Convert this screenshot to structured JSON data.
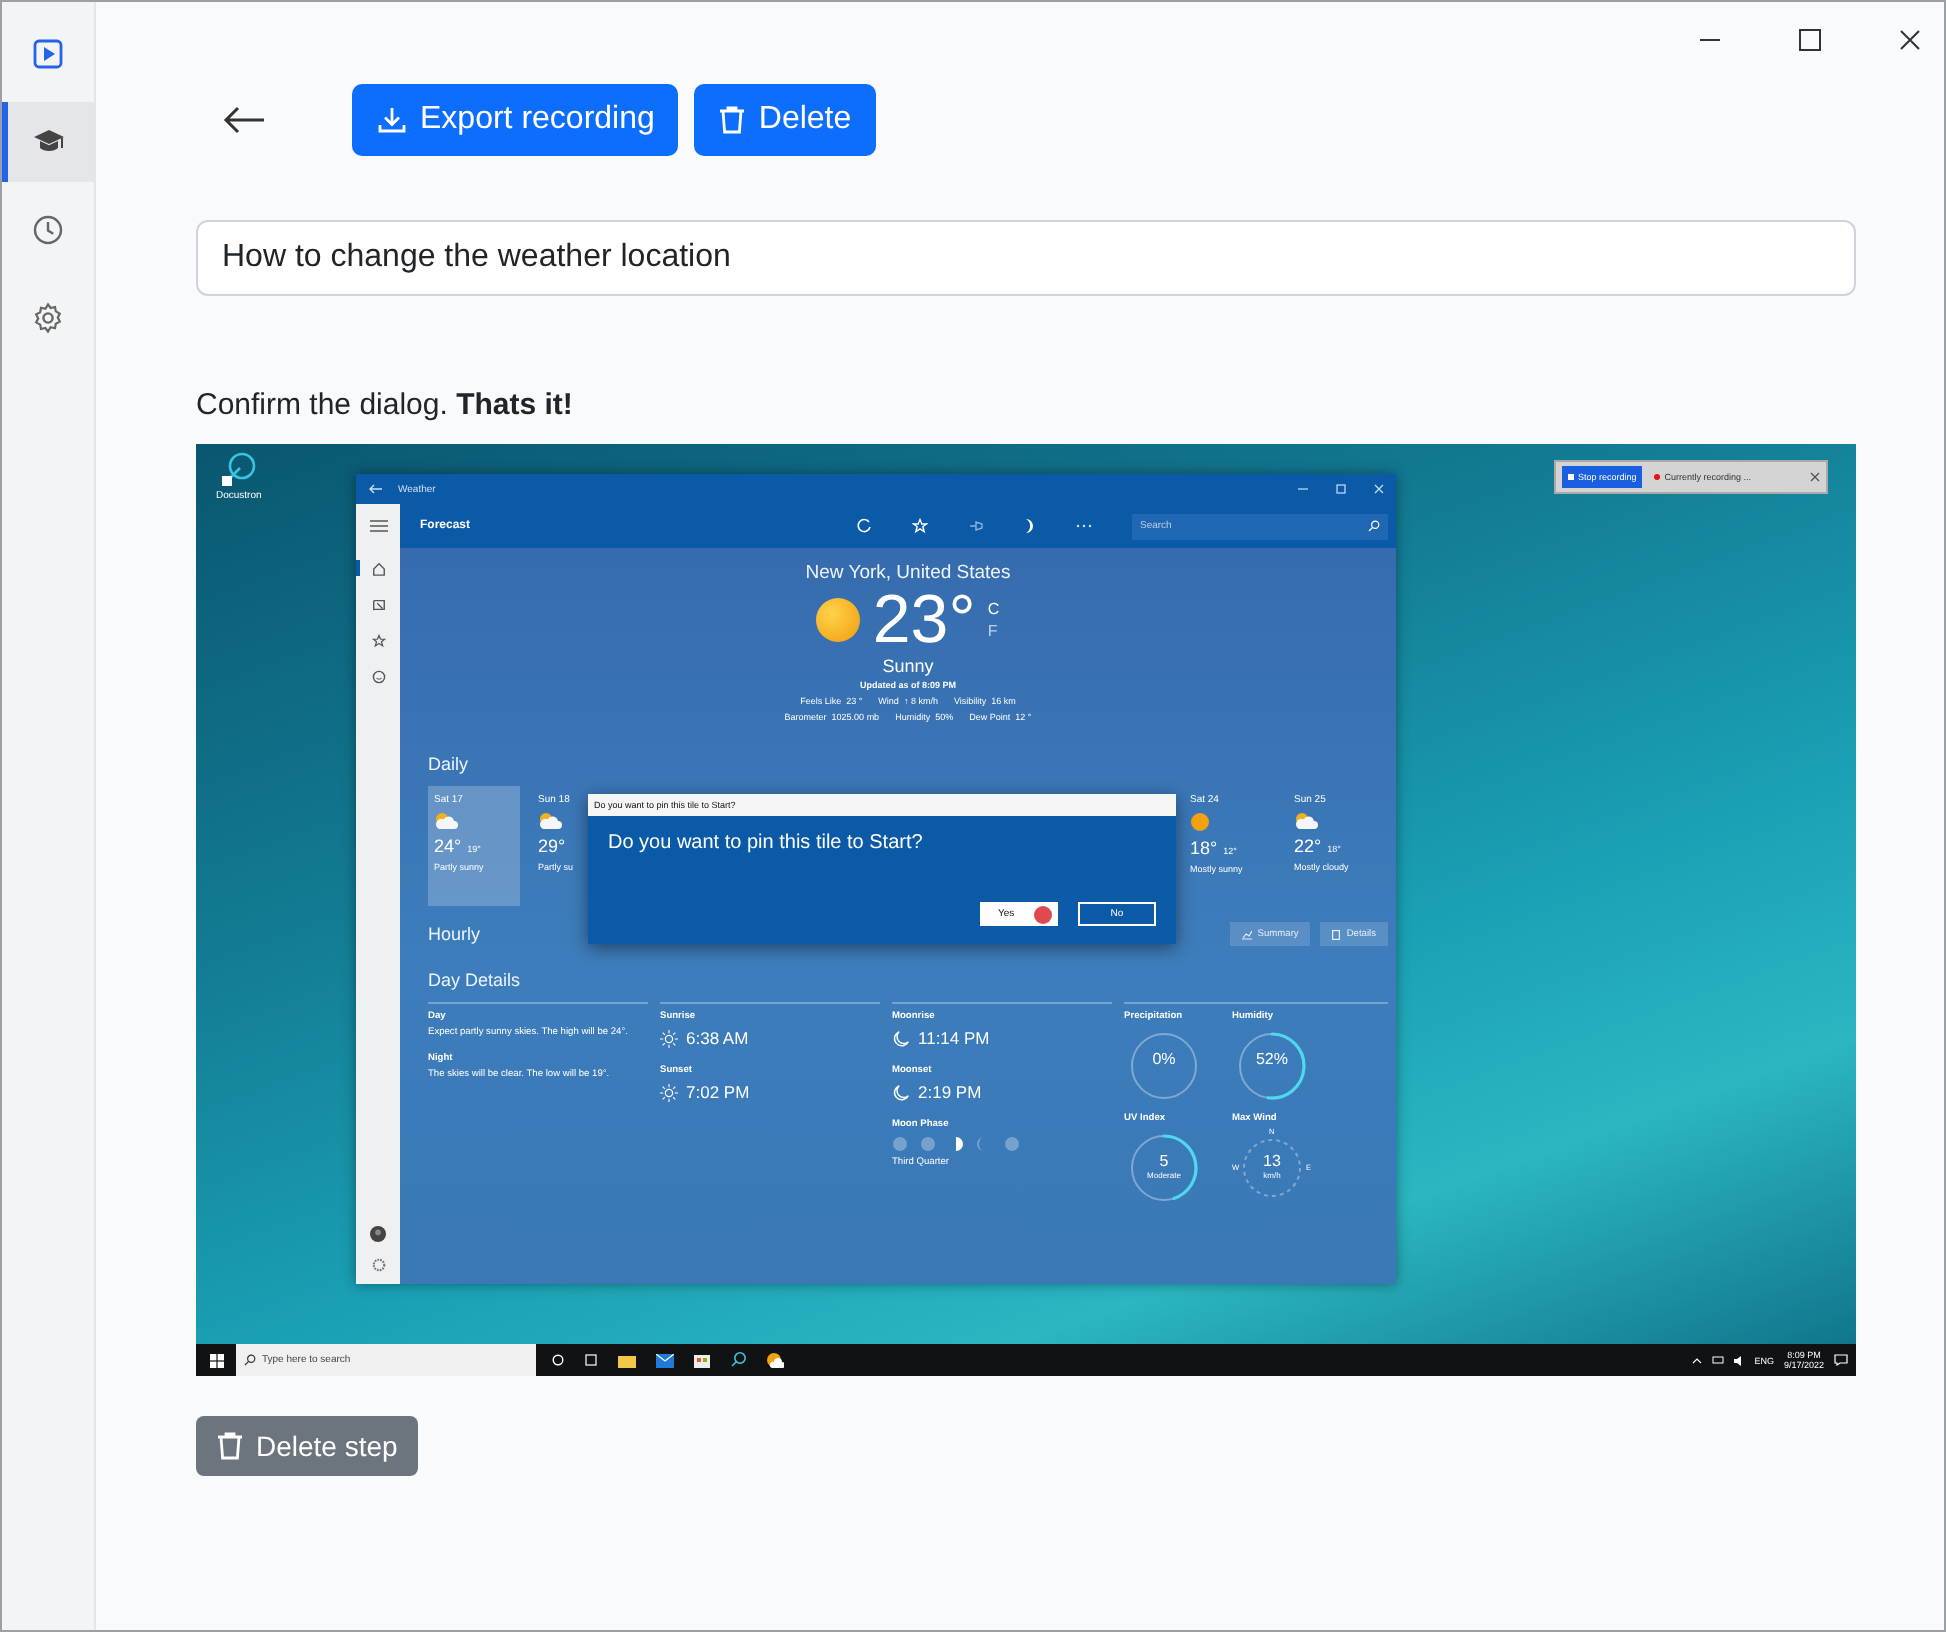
{
  "sidebar": {
    "items": [
      {
        "kind": "play",
        "selected": false
      },
      {
        "kind": "learn",
        "selected": true
      },
      {
        "kind": "history",
        "selected": false
      },
      {
        "kind": "settings",
        "selected": false
      }
    ]
  },
  "toolbar": {
    "buttons": [
      {
        "kind": "export",
        "label": "Export recording"
      },
      {
        "kind": "delete",
        "label": "Delete"
      }
    ]
  },
  "title_field": {
    "value": "How to change the weather location"
  },
  "step": {
    "description": "Confirm the dialog. **Thats it!**",
    "screenshot": {
      "desktop_icon": {
        "label": "Docustron"
      },
      "recorder": {
        "stop_button": "Stop recording",
        "status": "Currently recording ..."
      },
      "weather": {
        "title": "Weather",
        "header": "Forecast",
        "search_placeholder": "Search",
        "nav": [
          {
            "kind": "home",
            "selected": true
          },
          {
            "kind": "maps",
            "selected": false
          },
          {
            "kind": "favorites",
            "selected": false
          },
          {
            "kind": "news",
            "selected": false
          }
        ],
        "current": {
          "location": "New York, United States",
          "temperature": "23°",
          "units": [
            "C",
            "F"
          ],
          "condition": "Sunny",
          "updated": "Updated as of 8:09 PM",
          "details": [
            [
              {
                "label": "Feels Like",
                "value": "23 °"
              },
              {
                "label": "Wind",
                "value": "↑ 8 km/h"
              },
              {
                "label": "Visibility",
                "value": "16 km"
              }
            ],
            [
              {
                "label": "Barometer",
                "value": "1025.00 mb"
              },
              {
                "label": "Humidity",
                "value": "50%"
              },
              {
                "label": "Dew Point",
                "value": "12 °"
              }
            ]
          ]
        },
        "daily": {
          "heading": "Daily",
          "days": [
            {
              "day": "Sat 17",
              "high": "24°",
              "low": "19°",
              "summary": "Partly sunny",
              "kind": "partly-cloudy",
              "selected": true
            },
            {
              "day": "Sun 18",
              "high": "29°",
              "summary": "Partly su",
              "kind": "partly-cloudy",
              "selected": false
            },
            {
              "day": "Sat 24",
              "high": "18°",
              "low": "12°",
              "summary": "Mostly sunny",
              "kind": "sun",
              "selected": false
            },
            {
              "day": "Sun 25",
              "high": "22°",
              "low": "18°",
              "summary": "Mostly cloudy",
              "kind": "partly-cloudy",
              "selected": false
            }
          ]
        },
        "hourly": {
          "heading": "Hourly",
          "buttons": [
            {
              "kind": "chart",
              "label": "Summary"
            },
            {
              "kind": "list",
              "label": "Details"
            }
          ]
        },
        "day_details": {
          "heading": "Day Details",
          "texts": [
            {
              "label": "Day",
              "text": "Expect partly sunny skies. The high will be 24°."
            },
            {
              "label": "Night",
              "text": "The skies will be clear. The low will be 19°."
            }
          ],
          "sun": [
            {
              "label": "Sunrise",
              "value": "6:38 AM"
            },
            {
              "label": "Sunset",
              "value": "7:02 PM"
            }
          ],
          "moon": [
            {
              "label": "Moonrise",
              "value": "11:14 PM"
            },
            {
              "label": "Moonset",
              "value": "2:19 PM"
            }
          ],
          "moon_phase": {
            "label": "Moon Phase",
            "value": "Third Quarter"
          },
          "gauges": [
            {
              "kind": "ring",
              "label": "Precipitation",
              "value": "0%"
            },
            {
              "kind": "ring",
              "label": "Humidity",
              "value": "52%",
              "level": 0.52
            },
            {
              "kind": "ring",
              "label": "UV Index",
              "value": "5",
              "sub": "Moderate",
              "level": 0.45
            },
            {
              "kind": "compass",
              "label": "Max Wind",
              "value": "13",
              "sub": "km/h",
              "directions": [
                "N",
                "W",
                "E"
              ]
            }
          ]
        }
      },
      "dialog": {
        "title": "Do you want to pin this tile to Start?",
        "message": "Do you want to pin this tile to Start?",
        "buttons": [
          {
            "label": "Yes",
            "selected": true
          },
          {
            "label": "No",
            "selected": false
          }
        ]
      },
      "taskbar": {
        "search_placeholder": "Type here to search",
        "language": "ENG",
        "time": "8:09 PM",
        "date": "9/17/2022"
      }
    },
    "delete_button": {
      "label": "Delete step"
    }
  }
}
